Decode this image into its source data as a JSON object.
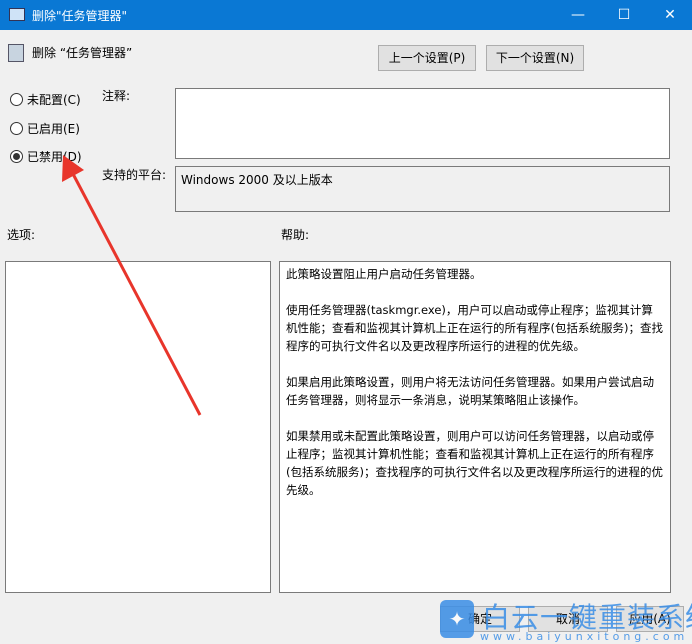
{
  "window": {
    "title": "删除\"任务管理器\"",
    "minimize": "—",
    "maximize": "☐",
    "close": "✕",
    "accent": "#0a78d4"
  },
  "header": {
    "policy_title": "删除 “任务管理器”",
    "prev_button": "上一个设置(P)",
    "next_button": "下一个设置(N)"
  },
  "state": {
    "options": [
      {
        "label": "未配置(C)",
        "selected": false
      },
      {
        "label": "已启用(E)",
        "selected": false
      },
      {
        "label": "已禁用(D)",
        "selected": true
      }
    ]
  },
  "comment": {
    "label": "注释:",
    "value": ""
  },
  "platform": {
    "label": "支持的平台:",
    "value": "Windows 2000 及以上版本"
  },
  "options_panel": {
    "label": "选项:"
  },
  "help_panel": {
    "label": "帮助:",
    "paragraphs": [
      "此策略设置阻止用户启动任务管理器。",
      "使用任务管理器(taskmgr.exe)，用户可以启动或停止程序；监视其计算机性能；查看和监视其计算机上正在运行的所有程序(包括系统服务)；查找程序的可执行文件名以及更改程序所运行的进程的优先级。",
      "如果启用此策略设置，则用户将无法访问任务管理器。如果用户尝试启动任务管理器，则将显示一条消息，说明某策略阻止该操作。",
      "如果禁用或未配置此策略设置，则用户可以访问任务管理器，以启动或停止程序；监视其计算机性能；查看和监视其计算机上正在运行的所有程序(包括系统服务)；查找程序的可执行文件名以及更改程序所运行的进程的优先级。"
    ]
  },
  "footer": {
    "ok": "确定",
    "cancel": "取消",
    "apply": "应用(A)"
  },
  "watermark": {
    "brand": "白云一键重装系统",
    "url": "www.baiyunxitong.com"
  },
  "annotation": {
    "arrow_color": "#e8352b"
  }
}
